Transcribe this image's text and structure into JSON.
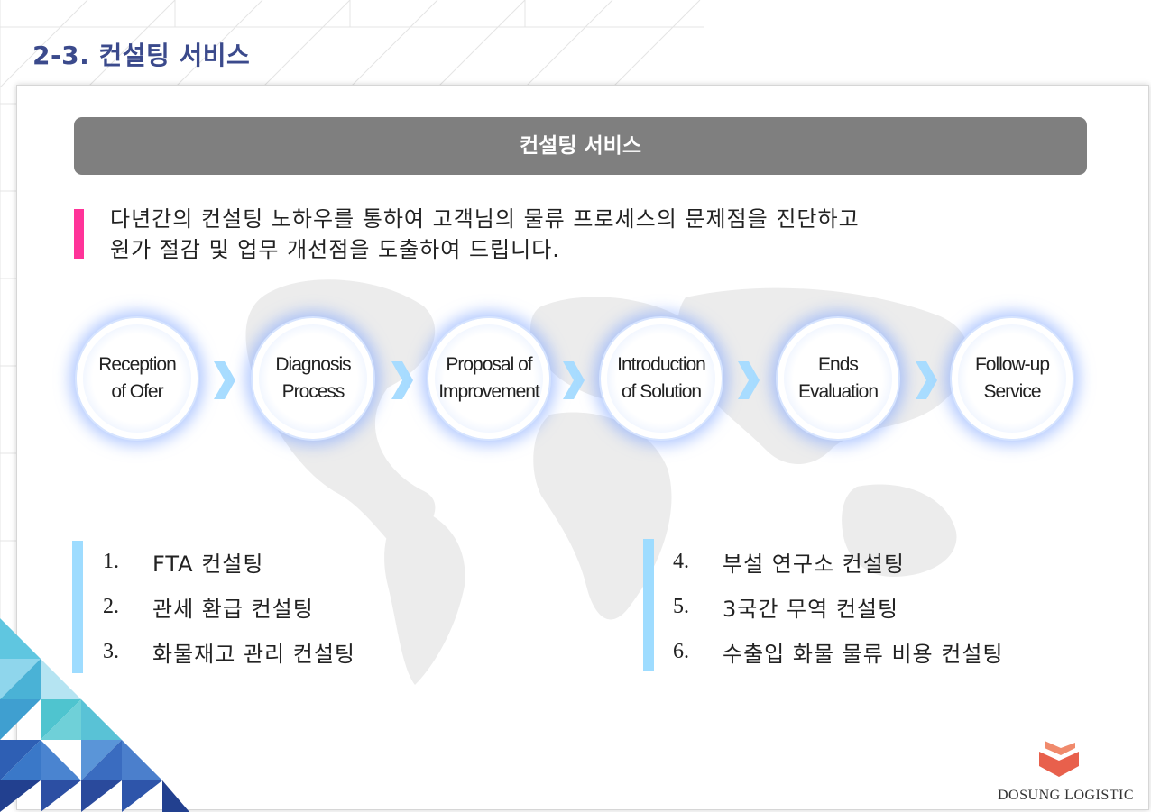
{
  "page": {
    "title": "2-3. 컨설팅 서비스"
  },
  "banner": {
    "label": "컨설팅 서비스"
  },
  "intro": {
    "line1": "다년간의 컨설팅 노하우를 통하여 고객님의 물류 프로세스의 문제점을 진단하고",
    "line2": "원가 절감 및 업무 개선점을 도출하여 드립니다."
  },
  "process": [
    {
      "label": "Reception\nof Ofer"
    },
    {
      "label": "Diagnosis\nProcess"
    },
    {
      "label": "Proposal of\nImprovement"
    },
    {
      "label": "Introduction\nof Solution"
    },
    {
      "label": "Ends\nEvaluation"
    },
    {
      "label": "Follow-up\nService"
    }
  ],
  "services_left": [
    {
      "num": "1.",
      "text": "FTA 컨설팅"
    },
    {
      "num": "2.",
      "text": "관세 환급 컨설팅"
    },
    {
      "num": "3.",
      "text": "화물재고 관리 컨설팅"
    }
  ],
  "services_right": [
    {
      "num": "4.",
      "text": "부설 연구소 컨설팅"
    },
    {
      "num": "5.",
      "text": "3국간 무역 컨설팅"
    },
    {
      "num": "6.",
      "text": "수출입 화물 물류 비용 컨설팅"
    }
  ],
  "brand": {
    "name": "DOSUNG LOGISTIC"
  },
  "colors": {
    "title": "#3b4a8c",
    "banner": "#7f7f7f",
    "accent_pink": "#ff3399",
    "accent_blue": "#9edcff",
    "arrow": "#a8dcff",
    "logo": "#e8604c"
  }
}
